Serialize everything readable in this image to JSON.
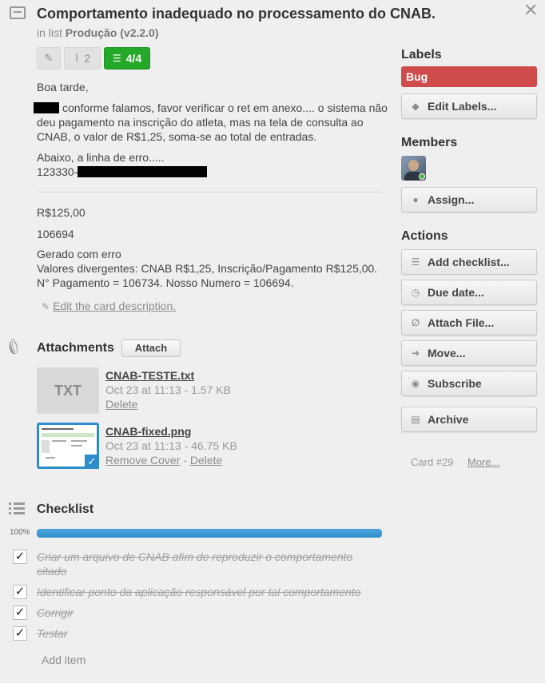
{
  "card": {
    "title": "Comportamento inadequado no processamento do CNAB.",
    "in_list_prefix": "in list",
    "list_name": "Produção (v2.2.0)"
  },
  "badges": {
    "attachments_count": "2",
    "checklist_progress": "4/4"
  },
  "description": {
    "greeting": "Boa tarde,",
    "para1": "conforme falamos, favor verificar o ret em anexo.... o sistema não deu pagamento na inscrição do atleta, mas na tela de consulta ao CNAB, o valor de R$1,25, soma-se ao total de entradas.",
    "para2_line1": "Abaixo, a linha de erro.....",
    "para2_line2": "123330-",
    "amount": "R$125,00",
    "number": "106694",
    "para3_line1": "Gerado com erro",
    "para3_line2": "Valores divergentes: CNAB R$1,25, Inscrição/Pagamento R$125,00.",
    "para3_line3": "N° Pagamento = 106734. Nosso Numero = 106694.",
    "edit_link": "Edit the card description."
  },
  "attachments": {
    "title": "Attachments",
    "attach_button": "Attach",
    "items": [
      {
        "thumb_label": "TXT",
        "name": "CNAB-TESTE.txt",
        "meta": "Oct 23 at 11:13 - 1.57 KB",
        "action1": "Delete"
      },
      {
        "name": "CNAB-fixed.png",
        "meta": "Oct 23 at 11:13 - 46.75 KB",
        "action1": "Remove Cover",
        "separator": " - ",
        "action2": "Delete"
      }
    ]
  },
  "checklist": {
    "title": "Checklist",
    "percent_label": "100%",
    "progress": 1.0,
    "items": [
      {
        "line1": "Criar um arquivo de CNAB afim de reproduzir o comportamento",
        "line2": "citado",
        "checked": true
      },
      {
        "line1": "Identificar ponto da aplicação responsável por tal comportamento",
        "checked": true
      },
      {
        "line1": "Corrigir",
        "checked": true
      },
      {
        "line1": "Testar",
        "checked": true
      }
    ],
    "add_item": "Add item"
  },
  "sidebar": {
    "labels_title": "Labels",
    "label_bug": "Bug",
    "edit_labels": "Edit Labels...",
    "members_title": "Members",
    "assign": "Assign...",
    "actions_title": "Actions",
    "add_checklist": "Add checklist...",
    "due_date": "Due date...",
    "attach_file": "Attach File...",
    "move": "Move...",
    "subscribe": "Subscribe",
    "archive": "Archive",
    "card_number": "Card #29",
    "more": "More..."
  },
  "colors": {
    "label_bug": "#d04b4b",
    "badge_green": "#24a829",
    "progress_blue": "#2c8dca"
  }
}
